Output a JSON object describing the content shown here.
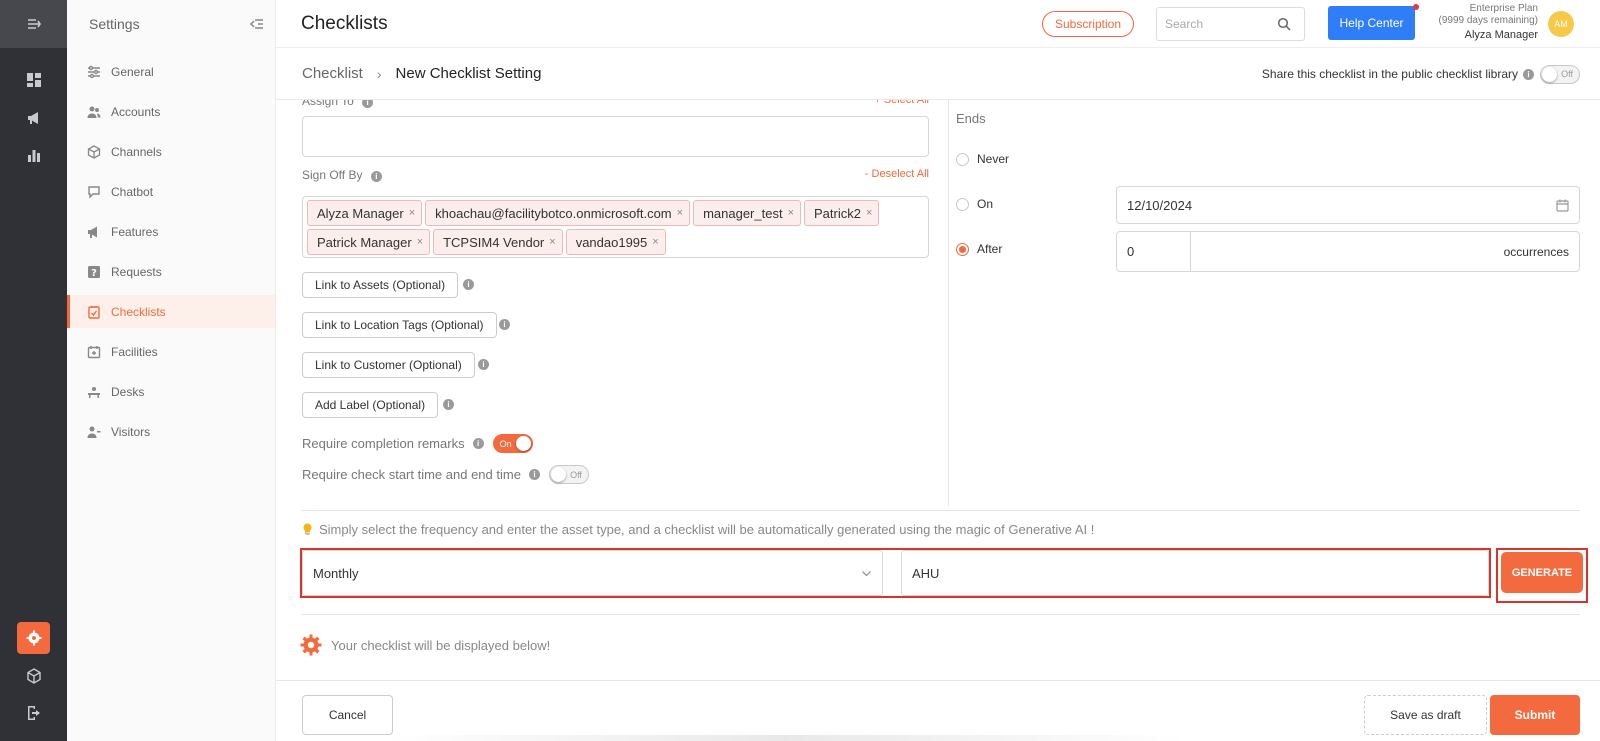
{
  "app": {
    "settings_title": "Settings",
    "page_title": "Checklists",
    "subscription_label": "Subscription",
    "search_placeholder": "Search",
    "help_center_label": "Help Center",
    "plan_name": "Enterprise Plan",
    "plan_remaining": "(9999 days remaining)",
    "user_name": "Alyza Manager",
    "avatar_initials": "AM",
    "accent_color": "#f26a3d",
    "help_color": "#2f7ef7"
  },
  "rail": {
    "icons": [
      "menu-expand-icon",
      "dashboard-icon",
      "megaphone-icon",
      "analytics-icon",
      "settings-gear-icon",
      "cube-icon",
      "logout-icon"
    ],
    "active": "settings-gear-icon"
  },
  "sidebar": {
    "items": [
      {
        "label": "General",
        "icon": "sliders-icon"
      },
      {
        "label": "Accounts",
        "icon": "users-icon"
      },
      {
        "label": "Channels",
        "icon": "box-icon"
      },
      {
        "label": "Chatbot",
        "icon": "chat-icon"
      },
      {
        "label": "Features",
        "icon": "megaphone-icon"
      },
      {
        "label": "Requests",
        "icon": "question-icon"
      },
      {
        "label": "Checklists",
        "icon": "clipboard-check-icon"
      },
      {
        "label": "Facilities",
        "icon": "calendar-plus-icon"
      },
      {
        "label": "Desks",
        "icon": "desk-icon"
      },
      {
        "label": "Visitors",
        "icon": "visitor-icon"
      }
    ],
    "active": "Checklists"
  },
  "breadcrumb": {
    "root": "Checklist",
    "current": "New Checklist Setting",
    "share_label": "Share this checklist in the public checklist library",
    "share_toggle": "Off"
  },
  "form": {
    "assign_to_label": "Assign To",
    "select_all_label": "+ Select All",
    "sign_off_label": "Sign Off By",
    "deselect_all_label": "- Deselect All",
    "sign_off_tags": [
      "Alyza Manager",
      "khoachau@facilitybotco.onmicrosoft.com",
      "manager_test",
      "Patrick2",
      "Patrick Manager",
      "TCPSIM4 Vendor",
      "vandao1995"
    ],
    "link_assets": "Link to Assets (Optional)",
    "link_location": "Link to Location Tags (Optional)",
    "link_customer": "Link to Customer (Optional)",
    "add_label": "Add Label (Optional)",
    "require_remarks_label": "Require completion remarks",
    "require_remarks_toggle": "On",
    "require_time_label": "Require check start time and end time",
    "require_time_toggle": "Off"
  },
  "ends": {
    "label": "Ends",
    "never": "Never",
    "on": "On",
    "after": "After",
    "selected": "After",
    "date_value": "12/10/2024",
    "occurrences_value": "0",
    "occurrences_unit": "occurrences"
  },
  "ai": {
    "note": "Simply select the frequency and enter the asset type, and a checklist will be automatically generated using the magic of Generative AI !",
    "frequency_value": "Monthly",
    "asset_value": "AHU",
    "generate_label": "GENERATE",
    "result_note": "Your checklist will be displayed below!"
  },
  "footer": {
    "cancel_label": "Cancel",
    "draft_label": "Save as draft",
    "submit_label": "Submit"
  }
}
